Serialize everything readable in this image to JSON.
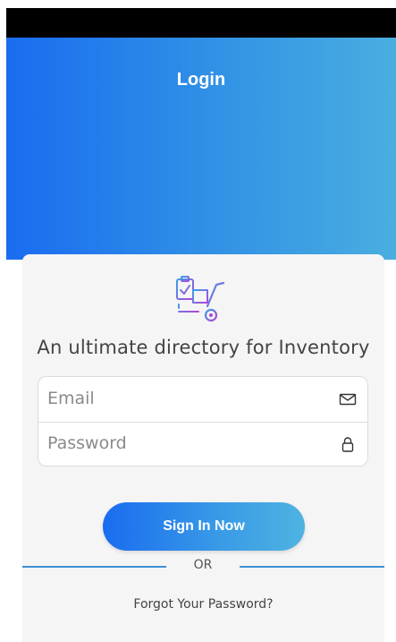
{
  "header": {
    "title": "Login"
  },
  "card": {
    "tagline": "An ultimate directory for Inventory"
  },
  "form": {
    "email": {
      "placeholder": "Email",
      "value": "",
      "icon": "envelope-icon"
    },
    "password": {
      "placeholder": "Password",
      "value": "",
      "icon": "lock-icon"
    }
  },
  "actions": {
    "signin_label": "Sign In Now",
    "divider_text": "OR",
    "forgot_label": "Forgot Your Password?"
  },
  "colors": {
    "gradient_start": "#1a6cf0",
    "gradient_end": "#4aaee0",
    "divider": "#3f8fd6"
  }
}
